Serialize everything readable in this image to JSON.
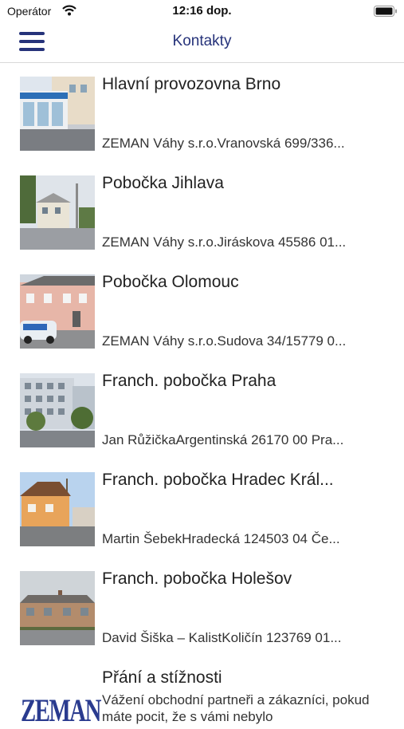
{
  "status_bar": {
    "carrier": "Operátor",
    "time": "12:16 dop."
  },
  "nav": {
    "title": "Kontakty"
  },
  "contacts": [
    {
      "title": "Hlavní provozovna Brno",
      "subtitle": "ZEMAN Váhy s.r.o.Vranovská 699/336..."
    },
    {
      "title": "Pobočka Jihlava",
      "subtitle": "ZEMAN Váhy s.r.o.Jiráskova 45586 01..."
    },
    {
      "title": "Pobočka Olomouc",
      "subtitle": "ZEMAN Váhy s.r.o.Sudova 34/15779 0..."
    },
    {
      "title": "Franch. pobočka Praha",
      "subtitle": "Jan RůžičkaArgentinská 26170 00 Pra..."
    },
    {
      "title": "Franch. pobočka Hradec Král...",
      "subtitle": "Martin ŠebekHradecká 124503 04 Če..."
    },
    {
      "title": "Franch. pobočka Holešov",
      "subtitle": "David Šiška – KalistKoličín 123769 01..."
    }
  ],
  "feedback": {
    "title": "Přání a stížnosti",
    "description": "Vážení obchodní partneři a zákazníci, pokud máte pocit, že s vámi nebylo",
    "logo_text": "ZEMAN"
  },
  "colors": {
    "accent": "#26337a",
    "divider": "#d8d8d8"
  }
}
